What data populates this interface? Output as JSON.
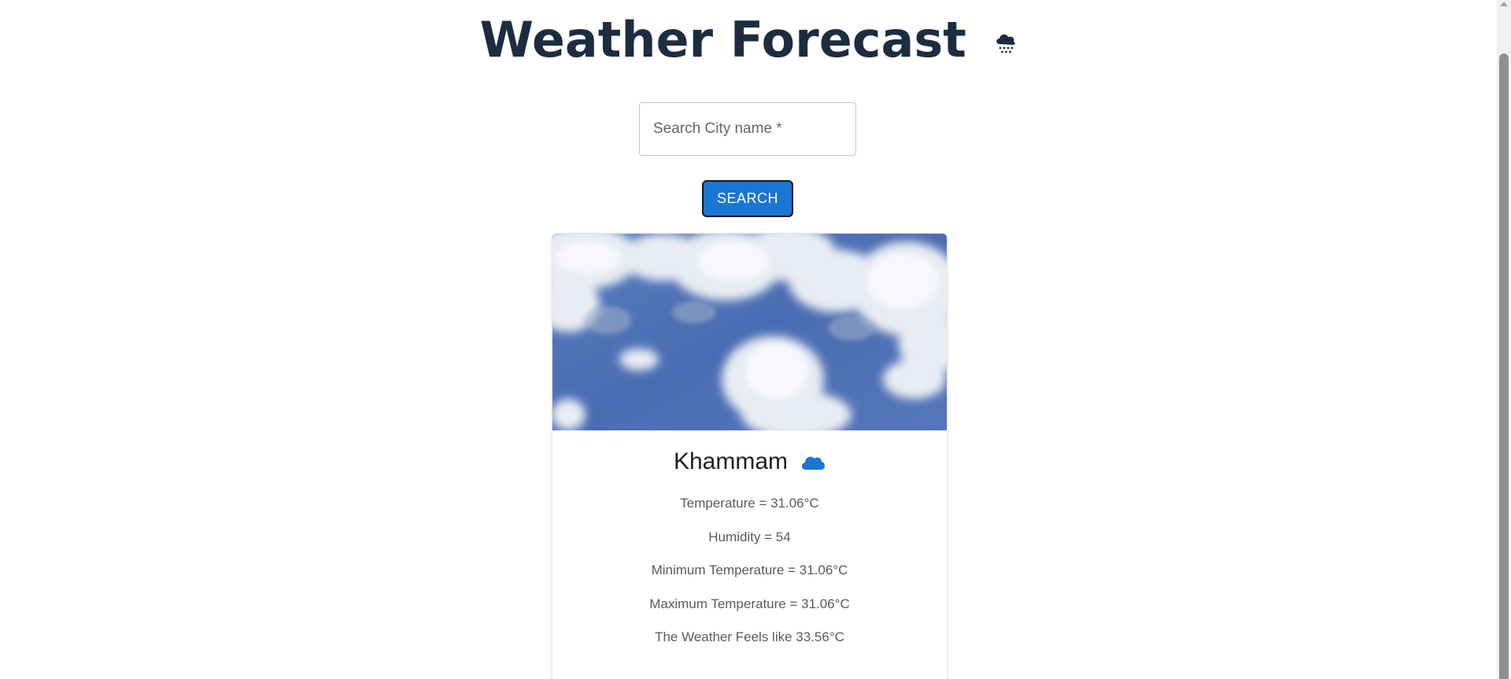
{
  "header": {
    "title": "Weather Forecast",
    "icon": "snow-cloud-icon"
  },
  "search": {
    "placeholder": "Search City name *",
    "value": "",
    "button_label": "SEARCH"
  },
  "weather_card": {
    "image": "sky-with-clouds-image",
    "city": "Khammam",
    "condition_icon": "cloud-icon",
    "temperature": "Temperature = 31.06°C",
    "humidity": "Humidity = 54",
    "min_temperature": "Minimum Temperature = 31.06°C",
    "max_temperature": "Maximum Temperature = 31.06°C",
    "feels_like": "The Weather Feels like 33.56°C"
  },
  "colors": {
    "title": "#1c2d40",
    "button": "#1976d2",
    "cloud_icon": "#1976d2",
    "sky": "#4a6eb4"
  }
}
